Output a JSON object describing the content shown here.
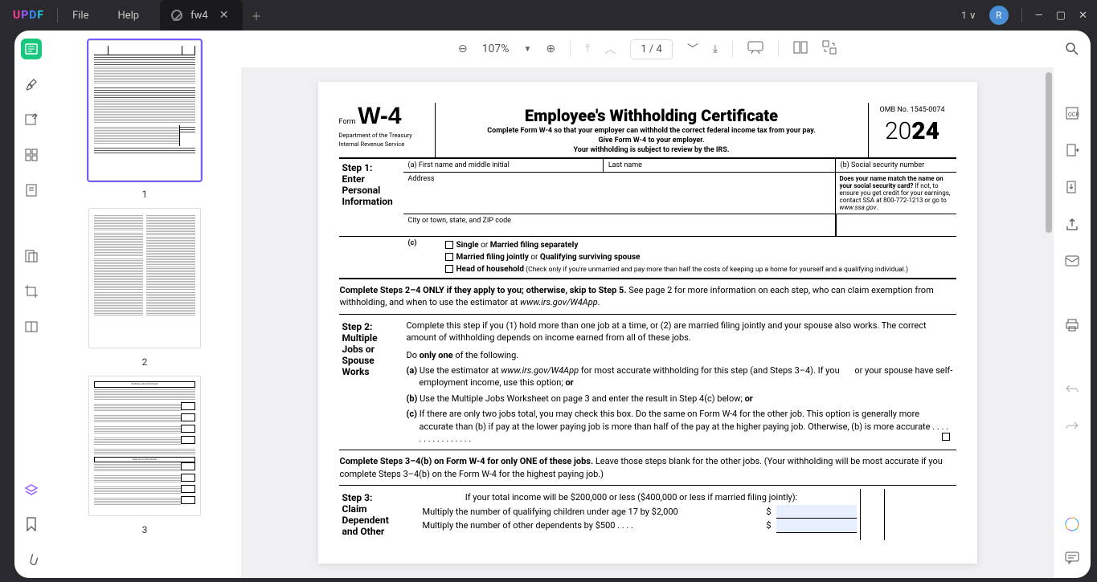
{
  "menu": {
    "file": "File",
    "help": "Help"
  },
  "tab": {
    "title": "fw4"
  },
  "title_right": {
    "onev": "1 ∨",
    "avatar": "R"
  },
  "toolbar": {
    "zoom": "107%",
    "page": "1 / 4"
  },
  "thumbs": {
    "p1": "1",
    "p2": "2",
    "p3": "3"
  },
  "form": {
    "formword": "Form",
    "w4": "W-4",
    "dept1": "Department of the Treasury",
    "dept2": "Internal Revenue Service",
    "title": "Employee's Withholding Certificate",
    "sub1": "Complete Form W-4 so that your employer can withhold the correct federal income tax from your pay.",
    "sub2": "Give Form W-4 to your employer.",
    "sub3": "Your withholding is subject to review by the IRS.",
    "omb": "OMB No. 1545-0074",
    "year_tw": "20",
    "year_yy": "24",
    "step1_label": "Step 1:",
    "step1_title": "Enter Personal Information",
    "fa_label": "(a)   First name and middle initial",
    "last_label": "Last name",
    "fb_label": "(b)   Social security number",
    "addr_label": "Address",
    "city_label": "City or town, state, and ZIP code",
    "ssn_note": "Does your name match the name on your social security card? If not, to ensure you get credit for your earnings, contact SSA at 800-772-1213 or go to www.ssa.gov.",
    "fc": "(c)",
    "filing_single": "Single or Married filing separately",
    "filing_joint": "Married filing jointly or Qualifying surviving spouse",
    "filing_hoh": "Head of household",
    "hoh_note": " (Check only if you're unmarried and pay more than half the costs of keeping up a home for yourself and a qualifying individual.)",
    "para1a": "Complete Steps 2–4 ONLY if they apply to you; otherwise, skip to Step 5.",
    "para1b": " See page 2 for more information on each step, who can claim exemption from withholding, and when to use the estimator at ",
    "para1c": "www.irs.gov/W4App",
    "step2_label": "Step 2:",
    "step2_title": "Multiple Jobs or Spouse Works",
    "step2_intro": "Complete this step if you (1) hold more than one job at a time, or (2) are married filing jointly and your spouse also works. The correct amount of withholding depends on income earned from all of these jobs.",
    "step2_do": "Do only one of the following.",
    "step2_a": "Use the estimator at www.irs.gov/W4App for most accurate withholding for this step (and Steps 3–4). If you or your spouse have self-employment income, use this option; or",
    "step2_b": "Use the Multiple Jobs Worksheet on page 3 and enter the result in Step 4(c) below; or",
    "step2_c": "If there are only two jobs total, you may check this box. Do the same on Form W-4 for the other job. This option is generally more accurate than (b) if pay at the lower paying job is more than half of the pay at the higher paying job. Otherwise, (b) is more accurate   .   .   .   .   .   .   .   .   .   .   .   .   .   .   .   .",
    "para2a": "Complete Steps 3–4(b) on Form W-4 for only ONE of these jobs.",
    "para2b": " Leave those steps blank for the other jobs. (Your withholding will be most accurate if you complete Steps 3–4(b) on the Form W-4 for the highest paying job.)",
    "step3_label": "Step 3:",
    "step3_title": "Claim Dependent and Other",
    "step3_intro": "If your total income will be $200,000 or less ($400,000 or less if married filing jointly):",
    "step3_l1": "Multiply the number of qualifying children under age 17 by $2,000",
    "step3_l2": "Multiply the number of other dependents by $500   .   .   .   .",
    "dollar": "$"
  }
}
